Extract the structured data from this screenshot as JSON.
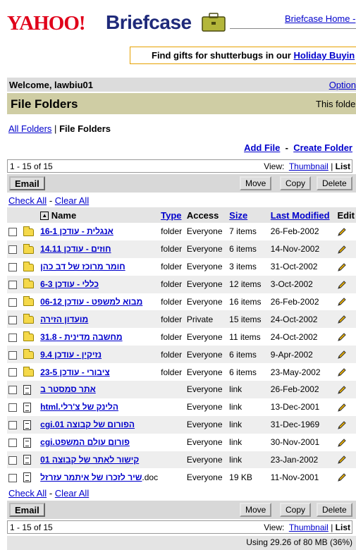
{
  "header": {
    "logo": "YAHOO!",
    "product": "Briefcase",
    "home_link": "Briefcase Home -"
  },
  "promo": {
    "text": "Find gifts for shutterbugs in our ",
    "link": "Holiday Buyin"
  },
  "welcome": {
    "text": "Welcome, lawbiu01",
    "options_link": "Option"
  },
  "title_bar": {
    "title": "File Folders",
    "note": "This folder"
  },
  "breadcrumb": {
    "all_folders": "All Folders",
    "separator": "|",
    "current": "File Folders"
  },
  "actions": {
    "add_file": "Add File",
    "separator": "-",
    "create_folder": "Create Folder"
  },
  "pager": {
    "range": "1 - 15 of 15",
    "view_label": "View:",
    "thumbnail": "Thumbnail",
    "divider": "|",
    "list": "List"
  },
  "toolbar": {
    "email": "Email",
    "move": "Move",
    "copy": "Copy",
    "delete": "Delete"
  },
  "check": {
    "check_all": "Check All",
    "separator": "-",
    "clear_all": "Clear All"
  },
  "table": {
    "columns": {
      "name": "Name",
      "type": "Type",
      "access": "Access",
      "size": "Size",
      "modified": "Last Modified",
      "edit": "Edit"
    },
    "rows": [
      {
        "icon": "folder-icon",
        "name": "אנגלית - עודכן 16-1",
        "suffix": "",
        "type": "folder",
        "access": "Everyone",
        "size": "7 items",
        "modified": "26-Feb-2002"
      },
      {
        "icon": "folder-icon",
        "name": "חוזים - עודכן 14.11",
        "suffix": "",
        "type": "folder",
        "access": "Everyone",
        "size": "6 items",
        "modified": "14-Nov-2002"
      },
      {
        "icon": "folder-icon",
        "name": "חומר מרוכז של דב כהן",
        "suffix": "",
        "type": "folder",
        "access": "Everyone",
        "size": "3 items",
        "modified": "31-Oct-2002"
      },
      {
        "icon": "folder-icon",
        "name": "כללי - עודכן 6-3",
        "suffix": "",
        "type": "folder",
        "access": "Everyone",
        "size": "12 items",
        "modified": "3-Oct-2002"
      },
      {
        "icon": "folder-icon",
        "name": "מבוא למשפט - עודכן 06-12",
        "suffix": "",
        "type": "folder",
        "access": "Everyone",
        "size": "16 items",
        "modified": "26-Feb-2002"
      },
      {
        "icon": "folder-icon",
        "name": "מועדון הזירה",
        "suffix": "",
        "type": "folder",
        "access": "Private",
        "size": "15 items",
        "modified": "24-Oct-2002"
      },
      {
        "icon": "folder-icon",
        "name": "מחשבה מדינית - 31.8",
        "suffix": "",
        "type": "folder",
        "access": "Everyone",
        "size": "11 items",
        "modified": "24-Oct-2002"
      },
      {
        "icon": "folder-icon",
        "name": "נזיקין - עודכן 9.4",
        "suffix": "",
        "type": "folder",
        "access": "Everyone",
        "size": "6 items",
        "modified": "9-Apr-2002"
      },
      {
        "icon": "folder-icon",
        "name": "ציבורי - עודכן 23-5",
        "suffix": "",
        "type": "folder",
        "access": "Everyone",
        "size": "6 items",
        "modified": "23-May-2002"
      },
      {
        "icon": "doc-icon",
        "name": "אתר סמסטר ב",
        "suffix": "",
        "type": "",
        "access": "Everyone",
        "size": "link",
        "modified": "26-Feb-2002"
      },
      {
        "icon": "doc-icon",
        "name": "הלינק של צ'רלי.html",
        "suffix": "",
        "type": "",
        "access": "Everyone",
        "size": "link",
        "modified": "13-Dec-2001"
      },
      {
        "icon": "doc-icon",
        "name": "הפורום של קבוצה 01.cgi",
        "suffix": "",
        "type": "",
        "access": "Everyone",
        "size": "link",
        "modified": "31-Dec-1969"
      },
      {
        "icon": "doc-icon",
        "name": "פורום עולם המשפט.cgi",
        "suffix": "",
        "type": "",
        "access": "Everyone",
        "size": "link",
        "modified": "30-Nov-2001"
      },
      {
        "icon": "doc-icon",
        "name": "קישור לאתר של קבוצה 01",
        "suffix": "",
        "type": "",
        "access": "Everyone",
        "size": "link",
        "modified": "23-Jan-2002"
      },
      {
        "icon": "doc-icon",
        "name": "שיר לזכרו של איתמר עזרזל",
        "suffix": ".doc",
        "type": "",
        "access": "Everyone",
        "size": "19 KB",
        "modified": "11-Nov-2001"
      }
    ]
  },
  "usage": {
    "text": "Using 29.26 of 80 MB (36%)"
  },
  "colors": {
    "yahoo_red": "#e0001a",
    "briefcase_blue": "#1f2a7a",
    "title_bar": "#cfcda4",
    "link": "#0000cc"
  }
}
